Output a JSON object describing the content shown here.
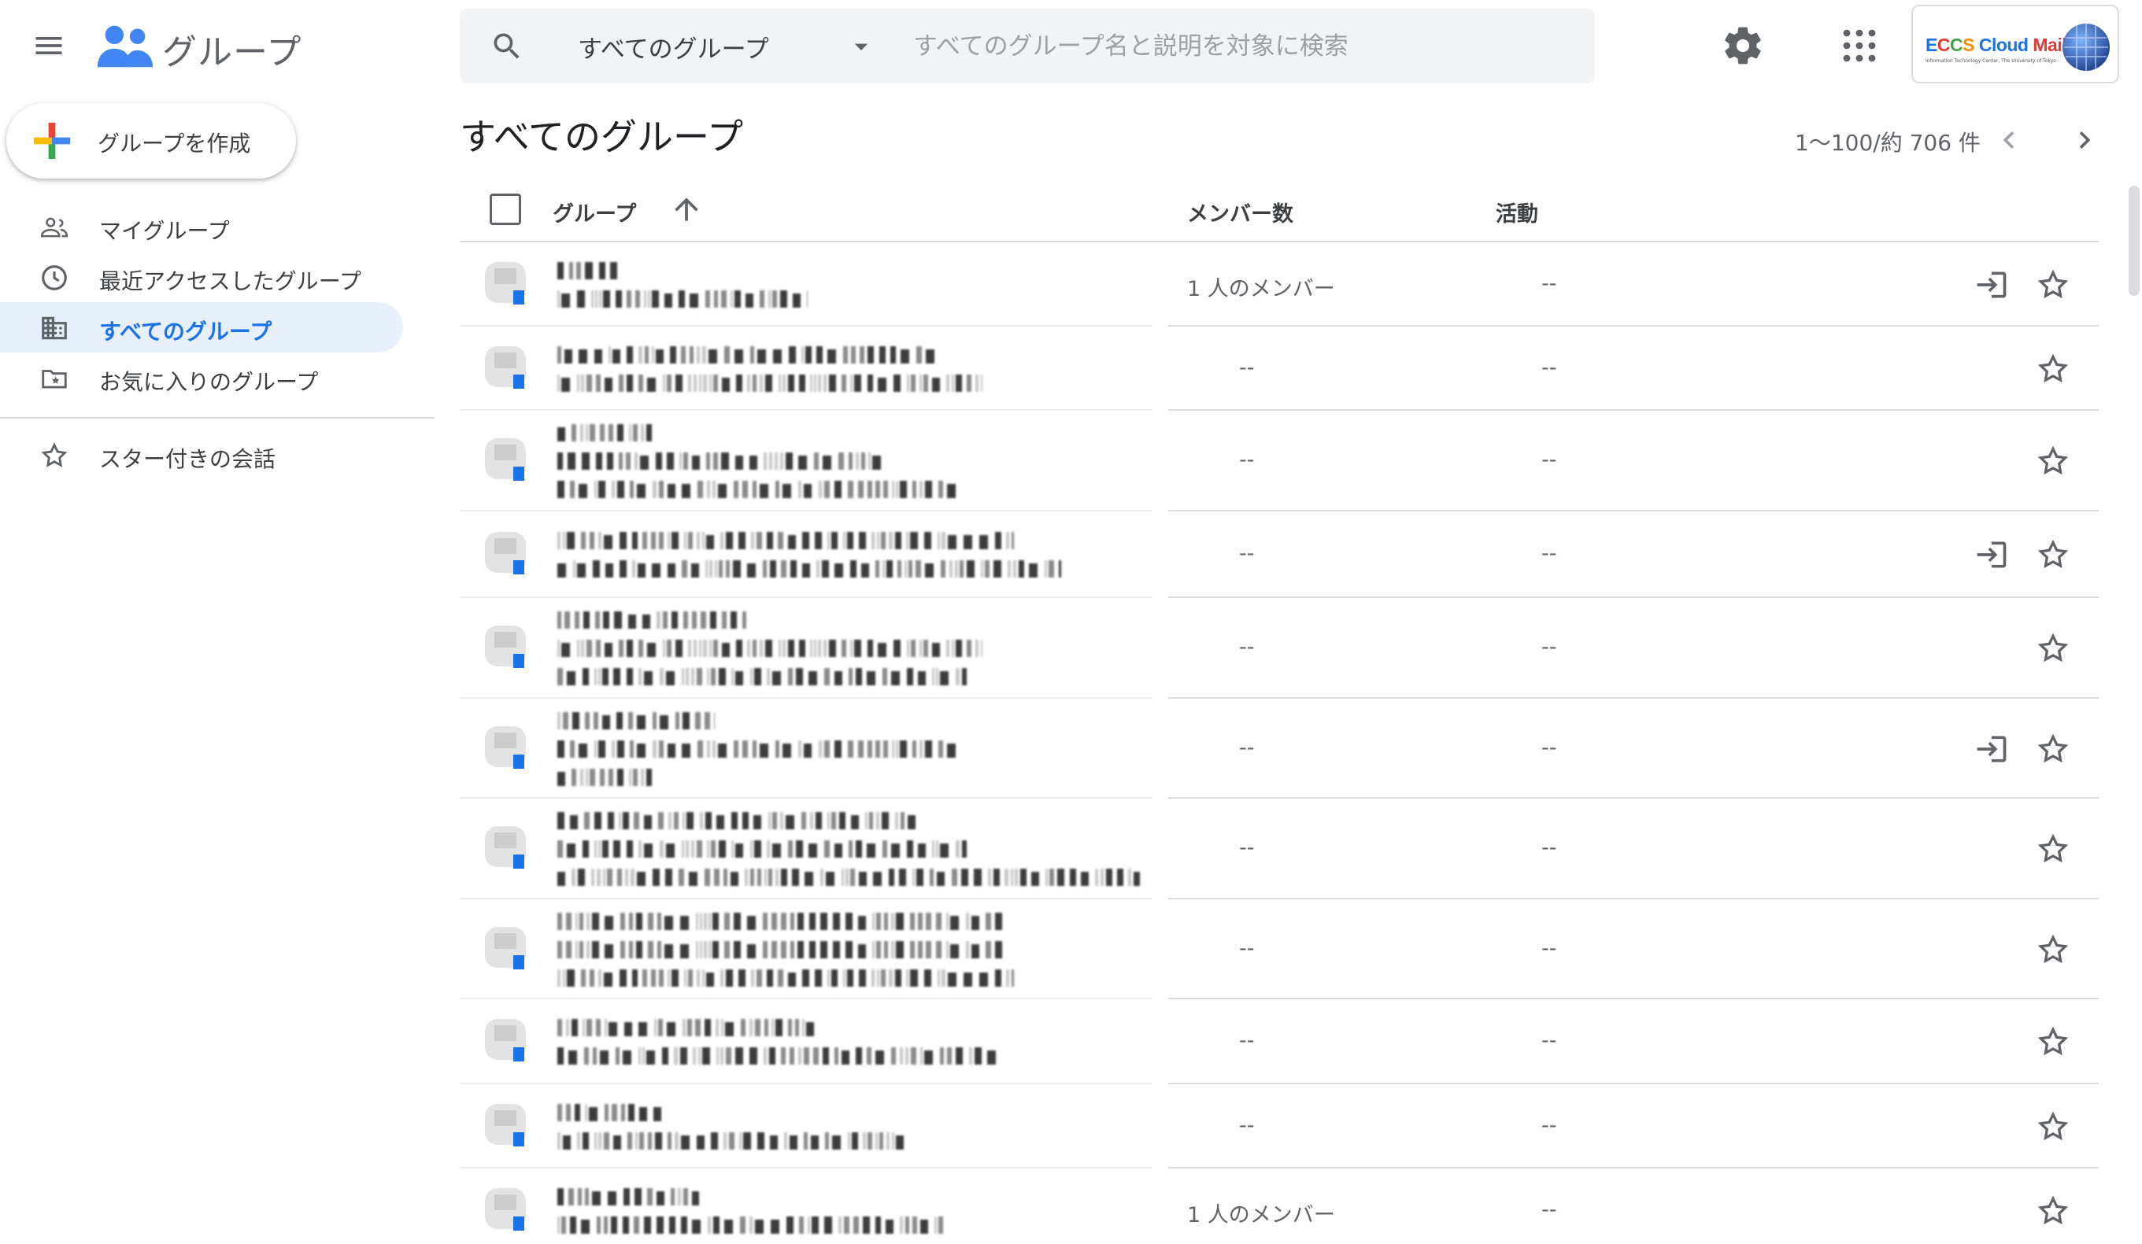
{
  "app": {
    "title": "グループ"
  },
  "search": {
    "scope_label": "すべてのグループ",
    "placeholder": "すべてのグループ名と説明を対象に検索"
  },
  "brand": {
    "name": "ECCS Cloud Mail",
    "subtitle": "Information Technology Center, The University of Tokyo"
  },
  "create_button": {
    "label": "グループを作成"
  },
  "sidebar": {
    "items": [
      {
        "label": "マイグループ",
        "icon": "people-icon"
      },
      {
        "label": "最近アクセスしたグループ",
        "icon": "clock-icon"
      },
      {
        "label": "すべてのグループ",
        "icon": "building-icon",
        "active": true
      },
      {
        "label": "お気に入りのグループ",
        "icon": "star-folder-icon"
      }
    ],
    "starred": {
      "label": "スター付きの会話",
      "icon": "star-icon"
    }
  },
  "main": {
    "title": "すべてのグループ",
    "pagination": {
      "text": "1～100/約 706 件"
    },
    "columns": {
      "group": "グループ",
      "members": "メンバー数",
      "activity": "活動"
    }
  },
  "rows": [
    {
      "members": "1 人のメンバー",
      "activity": "--",
      "can_join": true
    },
    {
      "members": "--",
      "activity": "--",
      "can_join": false
    },
    {
      "members": "--",
      "activity": "--",
      "can_join": false
    },
    {
      "members": "--",
      "activity": "--",
      "can_join": true
    },
    {
      "members": "--",
      "activity": "--",
      "can_join": false
    },
    {
      "members": "--",
      "activity": "--",
      "can_join": true
    },
    {
      "members": "--",
      "activity": "--",
      "can_join": false
    },
    {
      "members": "--",
      "activity": "--",
      "can_join": false
    },
    {
      "members": "--",
      "activity": "--",
      "can_join": false
    },
    {
      "members": "--",
      "activity": "--",
      "can_join": false
    },
    {
      "members": "1 人のメンバー",
      "activity": "--",
      "can_join": false
    }
  ],
  "colors": {
    "accent": "#1a73e8",
    "active_bg": "#e8f0fe",
    "search_bg": "#f1f3f4"
  }
}
